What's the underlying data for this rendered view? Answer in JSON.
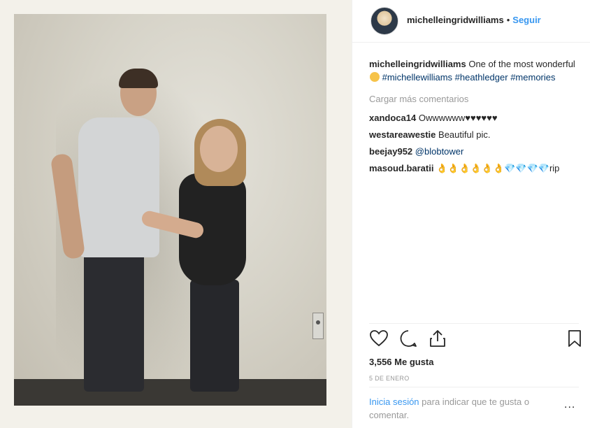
{
  "post": {
    "username": "michelleingridwilliams",
    "separator": "•",
    "follow_label": "Seguir",
    "caption": {
      "username": "michelleingridwilliams",
      "text": "One of the most wonderful",
      "hashtags": [
        "#michellewilliams",
        "#heathledger",
        "#memories"
      ]
    },
    "load_more": "Cargar más comentarios",
    "comments": [
      {
        "user": "xandoca14",
        "text": "Owwwwww♥♥♥♥♥♥"
      },
      {
        "user": "westareawestie",
        "text": "Beautiful pic."
      },
      {
        "user": "beejay952",
        "text": "@blobtower"
      },
      {
        "user": "masoud.baratii",
        "text": "👌👌👌👌👌👌💎💎💎💎rip"
      }
    ],
    "likes": "3,556 Me gusta",
    "date": "5 DE ENERO",
    "login": {
      "link": "Inicia sesión",
      "text": "para indicar que te gusta o comentar."
    },
    "more_label": "..."
  },
  "icons": {
    "like": "heart-icon",
    "comment": "comment-icon",
    "share": "share-icon",
    "save": "bookmark-icon",
    "more": "more-options-icon"
  },
  "colors": {
    "link_blue": "#3897f0",
    "hashtag": "#003569",
    "muted": "#999999"
  }
}
